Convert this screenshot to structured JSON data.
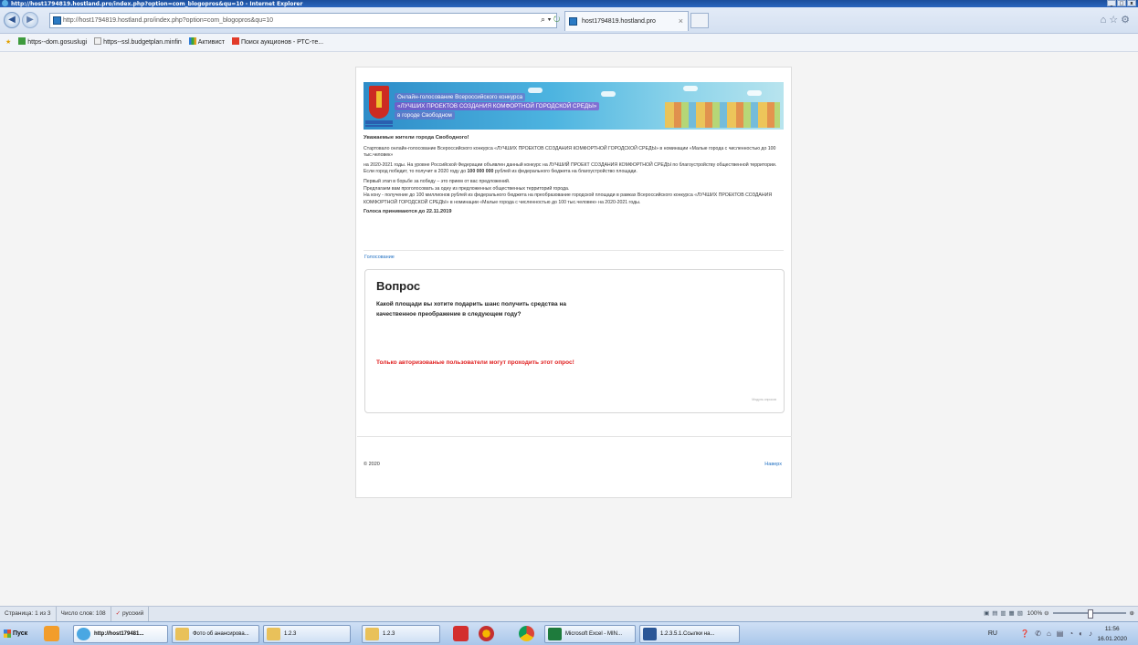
{
  "window": {
    "title": "http://host1794819.hostland.pro/index.php?option=com_blogopros&qu=10 - Internet Explorer"
  },
  "browser": {
    "address": "http://host1794819.hostland.pro/index.php?option=com_blogopros&qu=10",
    "tab_title": "host1794819.hostland.pro",
    "favorites": [
      {
        "label": "https--dom.gosuslugi",
        "icon": "green-icon"
      },
      {
        "label": "https--ssl.budgetplan.minfin",
        "icon": "page-icon"
      },
      {
        "label": "Активист",
        "icon": "chart-icon"
      },
      {
        "label": "Поиск аукционов - РТС-те...",
        "icon": "rts-icon"
      }
    ]
  },
  "page": {
    "banner": {
      "line1": "Онлайн-голосование Всероссийского конкурса",
      "line2": "«ЛУЧШИХ ПРОЕКТОВ СОЗДАНИЯ КОМФОРТНОЙ ГОРОДСКОЙ СРЕДЫ»",
      "line3": "в городе Свободном"
    },
    "greeting": "Уважаемые жители города Свободного!",
    "para1": "Стартовало онлайн-голосование Всероссийского конкурса «ЛУЧШИХ ПРОЕКТОВ СОЗДАНИЯ КОМФОРТНОЙ ГОРОДСКОЙ СРЕДЫ» в номинации «Малые города с численностью до 100 тыс.человек»",
    "para2": "на 2020-2021 годы. На уровне Российской Федерации объявлен данный конкурс на ЛУЧШИЙ ПРОЕКТ СОЗДАНИЯ КОМФОРТНОЙ СРЕДЫ по благоустройству общественной территории.",
    "para3_start": "Если город победит, то получит в 2020 году до ",
    "para3_amount": "100 000 000",
    "para3_end": " рублей из федерального бюджета на благоустройство площади.",
    "para4": "Первый этап в борьбе за победу – это прием от вас предложений.",
    "para5": "Предлагаем вам проголосовать за одну из предложенных общественных территорий города.",
    "para6": "На кону - получение до 100 миллионов рублей из федерального бюджета на преобразование городской площади в рамках Всероссийского конкурса «ЛУЧШИХ ПРОЕКТОВ СОЗДАНИЯ КОМФОРТНОЙ ГОРОДСКОЙ СРЕДЫ» в номинации «Малые города с численностью до 100 тыс.человек» на 2020-2021 годы.",
    "deadline": "Голоса принимаются до 22.11.2019",
    "vote_link": "Голосование",
    "poll": {
      "heading": "Вопрос",
      "question": "Какой площади вы хотите подарить шанс получить средства на качественное преображение в следующем году?",
      "error": "Только авторизованые пользователи могут проходить этот опрос!",
      "tiny": "Модуль опросов"
    },
    "copyright": "© 2020",
    "to_top": "Наверх"
  },
  "wordbar": {
    "page": "Страница: 1 из 3",
    "words": "Число слов: 108",
    "lang": "русский",
    "zoom": "100%"
  },
  "taskbar": {
    "start": "Пуск",
    "tasks": [
      {
        "label": "http://host179481..."
      },
      {
        "label": "Фото об анансирова..."
      },
      {
        "label": "1.2.3"
      },
      {
        "label": "1.2.3"
      },
      {
        "label": "Microsoft Excel - MIN..."
      },
      {
        "label": "1.2.3.5.1.Ссылки на..."
      }
    ],
    "lang": "RU",
    "time": "11:56",
    "date": "16.01.2020"
  }
}
